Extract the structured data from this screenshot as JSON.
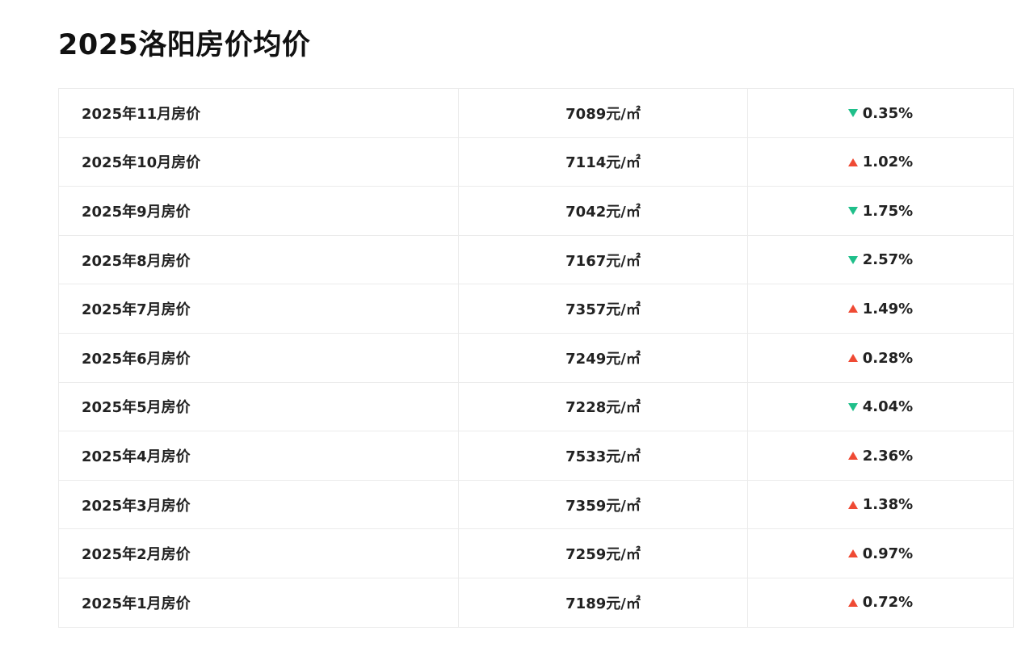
{
  "page": {
    "title": "2025洛阳房价均价"
  },
  "colors": {
    "up": "#ef4a34",
    "down": "#1fbf8a",
    "border": "#ebebeb"
  },
  "rows": [
    {
      "month": "2025年11月房价",
      "price": "7089元/㎡",
      "direction": "down",
      "change": "0.35%"
    },
    {
      "month": "2025年10月房价",
      "price": "7114元/㎡",
      "direction": "up",
      "change": "1.02%"
    },
    {
      "month": "2025年9月房价",
      "price": "7042元/㎡",
      "direction": "down",
      "change": "1.75%"
    },
    {
      "month": "2025年8月房价",
      "price": "7167元/㎡",
      "direction": "down",
      "change": "2.57%"
    },
    {
      "month": "2025年7月房价",
      "price": "7357元/㎡",
      "direction": "up",
      "change": "1.49%"
    },
    {
      "month": "2025年6月房价",
      "price": "7249元/㎡",
      "direction": "up",
      "change": "0.28%"
    },
    {
      "month": "2025年5月房价",
      "price": "7228元/㎡",
      "direction": "down",
      "change": "4.04%"
    },
    {
      "month": "2025年4月房价",
      "price": "7533元/㎡",
      "direction": "up",
      "change": "2.36%"
    },
    {
      "month": "2025年3月房价",
      "price": "7359元/㎡",
      "direction": "up",
      "change": "1.38%"
    },
    {
      "month": "2025年2月房价",
      "price": "7259元/㎡",
      "direction": "up",
      "change": "0.97%"
    },
    {
      "month": "2025年1月房价",
      "price": "7189元/㎡",
      "direction": "up",
      "change": "0.72%"
    }
  ]
}
